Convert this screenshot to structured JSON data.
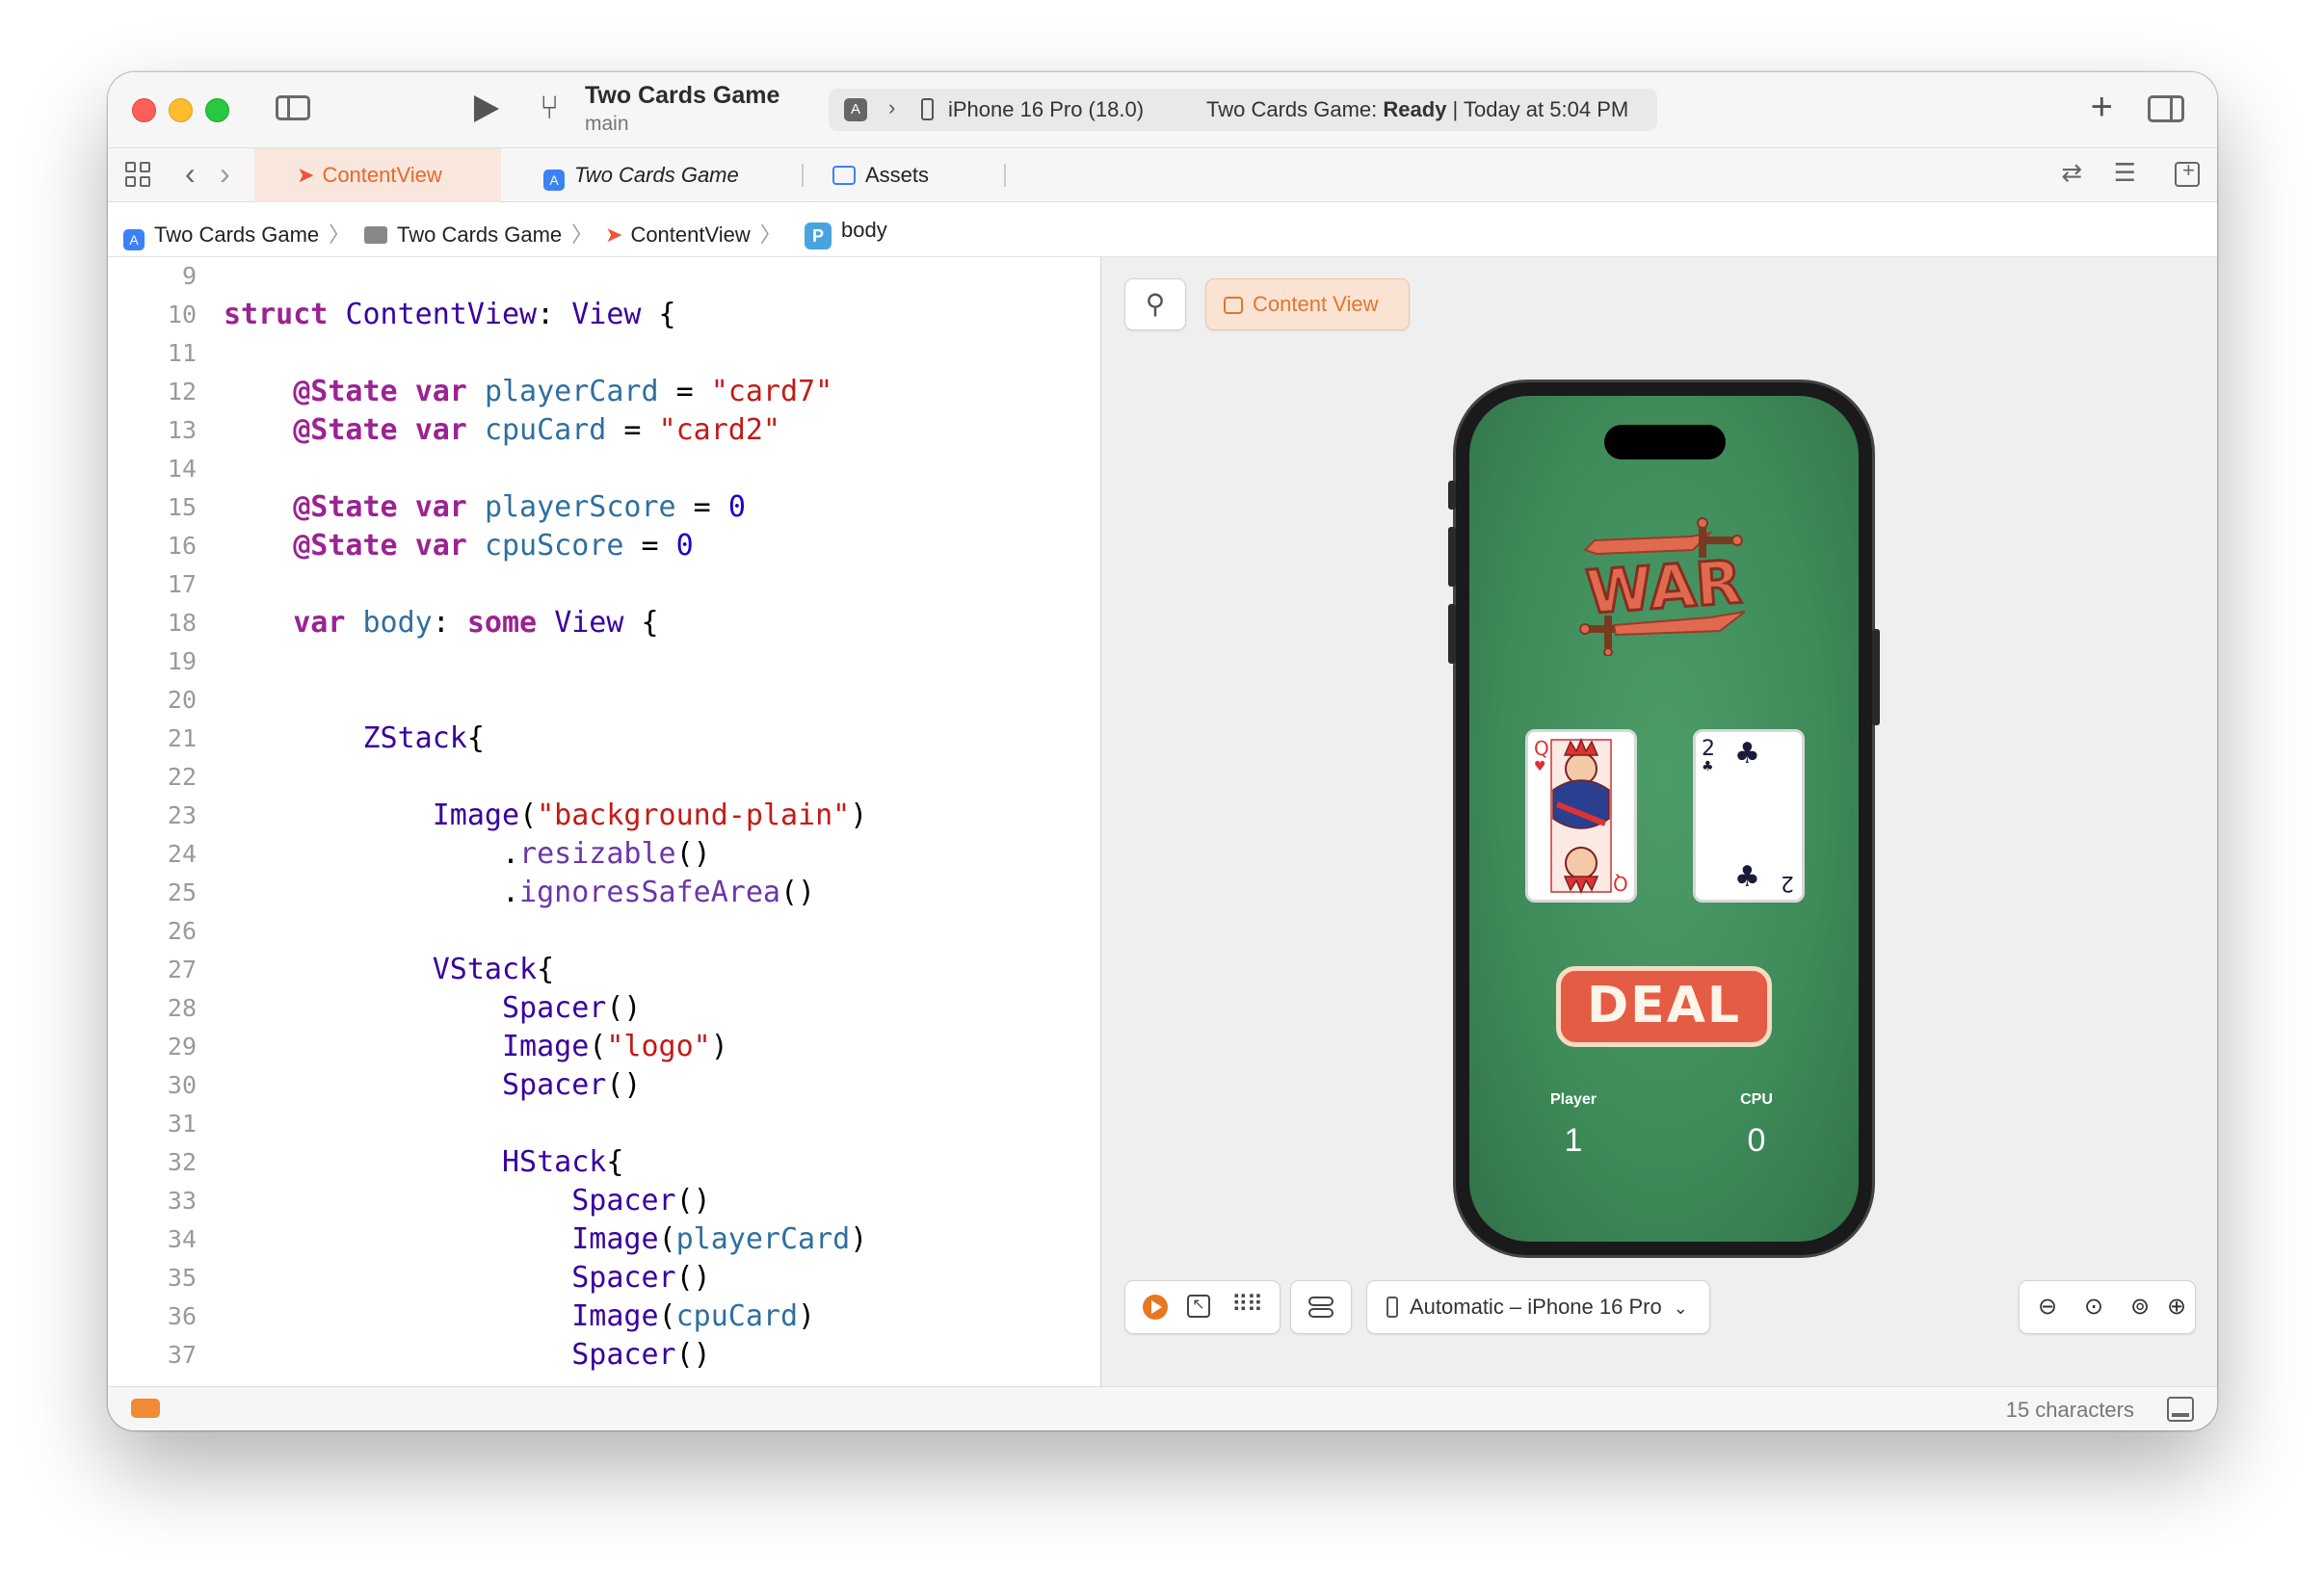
{
  "toolbar": {
    "scheme_title": "Two Cards Game",
    "branch": "main",
    "device": "iPhone 16 Pro (18.0)",
    "status_prefix": "Two Cards Game: ",
    "status_state": "Ready",
    "status_time": " | Today at 5:04 PM"
  },
  "tabs": [
    {
      "label": "ContentView",
      "active": true,
      "icon": "swift-icon"
    },
    {
      "label": "Two Cards Game",
      "active": false,
      "icon": "app-icon"
    },
    {
      "label": "Assets",
      "active": false,
      "icon": "assets-icon"
    }
  ],
  "breadcrumb": [
    {
      "label": "Two Cards Game",
      "icon": "app-icon"
    },
    {
      "label": "Two Cards Game",
      "icon": "folder-icon"
    },
    {
      "label": "ContentView",
      "icon": "swift-icon"
    },
    {
      "label": "body",
      "icon": "property-icon",
      "badge": "P"
    }
  ],
  "editor": {
    "lines": [
      {
        "n": "9",
        "tokens": []
      },
      {
        "n": "10",
        "tokens": [
          [
            "kw",
            "struct"
          ],
          [
            "plain",
            " "
          ],
          [
            "type",
            "ContentView"
          ],
          [
            "plain",
            ": "
          ],
          [
            "type",
            "View"
          ],
          [
            "plain",
            " {"
          ]
        ]
      },
      {
        "n": "11",
        "tokens": []
      },
      {
        "n": "12",
        "tokens": [
          [
            "plain",
            "    "
          ],
          [
            "kw",
            "@State"
          ],
          [
            "plain",
            " "
          ],
          [
            "kw",
            "var"
          ],
          [
            "plain",
            " "
          ],
          [
            "prop",
            "playerCard"
          ],
          [
            "plain",
            " = "
          ],
          [
            "str",
            "\"card7\""
          ]
        ]
      },
      {
        "n": "13",
        "tokens": [
          [
            "plain",
            "    "
          ],
          [
            "kw",
            "@State"
          ],
          [
            "plain",
            " "
          ],
          [
            "kw",
            "var"
          ],
          [
            "plain",
            " "
          ],
          [
            "prop",
            "cpuCard"
          ],
          [
            "plain",
            " = "
          ],
          [
            "str",
            "\"card2\""
          ]
        ]
      },
      {
        "n": "14",
        "tokens": []
      },
      {
        "n": "15",
        "tokens": [
          [
            "plain",
            "    "
          ],
          [
            "kw",
            "@State"
          ],
          [
            "plain",
            " "
          ],
          [
            "kw",
            "var"
          ],
          [
            "plain",
            " "
          ],
          [
            "prop",
            "playerScore"
          ],
          [
            "plain",
            " = "
          ],
          [
            "num",
            "0"
          ]
        ]
      },
      {
        "n": "16",
        "tokens": [
          [
            "plain",
            "    "
          ],
          [
            "kw",
            "@State"
          ],
          [
            "plain",
            " "
          ],
          [
            "kw",
            "var"
          ],
          [
            "plain",
            " "
          ],
          [
            "prop",
            "cpuScore"
          ],
          [
            "plain",
            " = "
          ],
          [
            "num",
            "0"
          ]
        ]
      },
      {
        "n": "17",
        "tokens": []
      },
      {
        "n": "18",
        "tokens": [
          [
            "plain",
            "    "
          ],
          [
            "kw",
            "var"
          ],
          [
            "plain",
            " "
          ],
          [
            "prop",
            "body"
          ],
          [
            "plain",
            ": "
          ],
          [
            "kw",
            "some"
          ],
          [
            "plain",
            " "
          ],
          [
            "type",
            "View"
          ],
          [
            "plain",
            " {"
          ]
        ]
      },
      {
        "n": "19",
        "tokens": []
      },
      {
        "n": "20",
        "tokens": []
      },
      {
        "n": "21",
        "tokens": [
          [
            "plain",
            "        "
          ],
          [
            "type",
            "ZStack"
          ],
          [
            "plain",
            "{"
          ]
        ]
      },
      {
        "n": "22",
        "tokens": []
      },
      {
        "n": "23",
        "tokens": [
          [
            "plain",
            "            "
          ],
          [
            "type",
            "Image"
          ],
          [
            "plain",
            "("
          ],
          [
            "str",
            "\"background-plain\""
          ],
          [
            "plain",
            ")"
          ]
        ]
      },
      {
        "n": "24",
        "tokens": [
          [
            "plain",
            "                ."
          ],
          [
            "fn",
            "resizable"
          ],
          [
            "plain",
            "()"
          ]
        ]
      },
      {
        "n": "25",
        "tokens": [
          [
            "plain",
            "                ."
          ],
          [
            "fn",
            "ignoresSafeArea"
          ],
          [
            "plain",
            "()"
          ]
        ]
      },
      {
        "n": "26",
        "tokens": []
      },
      {
        "n": "27",
        "tokens": [
          [
            "plain",
            "            "
          ],
          [
            "type",
            "VStack"
          ],
          [
            "plain",
            "{"
          ]
        ]
      },
      {
        "n": "28",
        "tokens": [
          [
            "plain",
            "                "
          ],
          [
            "type",
            "Spacer"
          ],
          [
            "plain",
            "()"
          ]
        ]
      },
      {
        "n": "29",
        "tokens": [
          [
            "plain",
            "                "
          ],
          [
            "type",
            "Image"
          ],
          [
            "plain",
            "("
          ],
          [
            "str",
            "\"logo\""
          ],
          [
            "plain",
            ")"
          ]
        ]
      },
      {
        "n": "30",
        "tokens": [
          [
            "plain",
            "                "
          ],
          [
            "type",
            "Spacer"
          ],
          [
            "plain",
            "()"
          ]
        ]
      },
      {
        "n": "31",
        "tokens": []
      },
      {
        "n": "32",
        "tokens": [
          [
            "plain",
            "                "
          ],
          [
            "type",
            "HStack"
          ],
          [
            "plain",
            "{"
          ]
        ]
      },
      {
        "n": "33",
        "tokens": [
          [
            "plain",
            "                    "
          ],
          [
            "type",
            "Spacer"
          ],
          [
            "plain",
            "()"
          ]
        ]
      },
      {
        "n": "34",
        "tokens": [
          [
            "plain",
            "                    "
          ],
          [
            "type",
            "Image"
          ],
          [
            "plain",
            "("
          ],
          [
            "prop",
            "playerCard"
          ],
          [
            "plain",
            ")"
          ]
        ]
      },
      {
        "n": "35",
        "tokens": [
          [
            "plain",
            "                    "
          ],
          [
            "type",
            "Spacer"
          ],
          [
            "plain",
            "()"
          ]
        ]
      },
      {
        "n": "36",
        "tokens": [
          [
            "plain",
            "                    "
          ],
          [
            "type",
            "Image"
          ],
          [
            "plain",
            "("
          ],
          [
            "prop",
            "cpuCard"
          ],
          [
            "plain",
            ")"
          ]
        ]
      },
      {
        "n": "37",
        "tokens": [
          [
            "plain",
            "                    "
          ],
          [
            "type",
            "Spacer"
          ],
          [
            "plain",
            "()"
          ]
        ]
      }
    ]
  },
  "canvas": {
    "preview_chip": "Content View",
    "device_select": "Automatic – iPhone 16 Pro",
    "game": {
      "logo_text": "WAR",
      "deal_label": "DEAL",
      "player_label": "Player",
      "cpu_label": "CPU",
      "player_score": "1",
      "cpu_score": "0",
      "player_card": {
        "rank": "Q",
        "suit": "♥"
      },
      "cpu_card": {
        "rank": "2",
        "suit": "♣"
      }
    }
  },
  "statusbar": {
    "char_count": "15 characters"
  },
  "colors": {
    "accent": "#e8682b",
    "felt": "#3f8c5a",
    "deal": "#e55c45"
  }
}
